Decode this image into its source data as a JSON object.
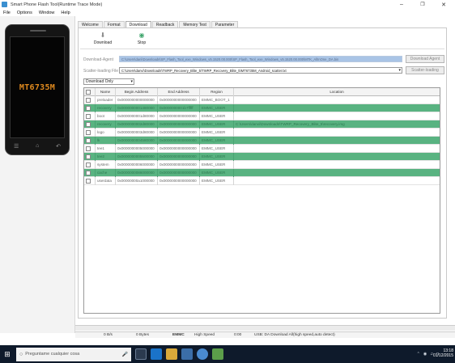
{
  "window": {
    "title": "Smart Phone Flash Tool(Runtime Trace Mode)"
  },
  "menubar": [
    "File",
    "Options",
    "Window",
    "Help"
  ],
  "phone": {
    "model": "MT6735M"
  },
  "tabs": [
    "Welcome",
    "Format",
    "Download",
    "Readback",
    "Memory Test",
    "Parameter"
  ],
  "toolbar": {
    "download_label": "Download",
    "stop_label": "Stop"
  },
  "fields": {
    "download_agent_label": "Download-Agent",
    "download_agent_value": "C:\\Users\\dani\\Downloads\\SP_Flash_Tool_exe_Windows_v5.1520.00.000\\SP_Flash_Tool_exe_Windows_v5.1520.00.000\\MTK_AllInOne_DA.bin",
    "download_agent_button": "Download Agent",
    "scatter_label": "Scatter-loading File",
    "scatter_value": "C:\\Users\\danvi\\Downloads\\TWRP_Recovery_Blite_5\\TWRP_Recovery_Blite_5\\MT6735M_Android_scatter.txt",
    "scatter_button": "Scatter-loading",
    "mode": "Download Only"
  },
  "table": {
    "headers": [
      "",
      "Name",
      "Begin Address",
      "End Address",
      "Region",
      "Location"
    ],
    "rows": [
      {
        "name": "preloader",
        "begin": "0x0000000000000000",
        "end": "0x0000000000000000",
        "region": "EMMC_BOOT_1",
        "location": "",
        "green": false
      },
      {
        "name": "recovery",
        "begin": "0x0000000001480000",
        "end": "0x0000000001b7fffff",
        "region": "EMMC_USER",
        "location": "",
        "green": true
      },
      {
        "name": "boot",
        "begin": "0x0000000001d80000",
        "end": "0x0000000000000000",
        "region": "EMMC_USER",
        "location": "",
        "green": false
      },
      {
        "name": "recovery",
        "begin": "0x0000000002d80000",
        "end": "0x0000000000000000",
        "region": "EMMC_USER",
        "location": "C:\\Users\\danvi\\Downloads\\TWRP_Recovery_Blite_5\\recovery.img",
        "green": true
      },
      {
        "name": "logo",
        "begin": "0x0000000003d80000",
        "end": "0x0000000000000000",
        "region": "EMMC_USER",
        "location": "",
        "green": false
      },
      {
        "name": "lk",
        "begin": "0x0000000004580000",
        "end": "0x0000000000000000",
        "region": "EMMC_USER",
        "location": "",
        "green": true
      },
      {
        "name": "tee1",
        "begin": "0x0000000005000000",
        "end": "0x0000000000000000",
        "region": "EMMC_USER",
        "location": "",
        "green": false
      },
      {
        "name": "tee2",
        "begin": "0x0000000005500000",
        "end": "0x0000000000000000",
        "region": "EMMC_USER",
        "location": "",
        "green": true
      },
      {
        "name": "system",
        "begin": "0x0000000006000000",
        "end": "0x0000000000000000",
        "region": "EMMC_USER",
        "location": "",
        "green": false
      },
      {
        "name": "cache",
        "begin": "0x0000000086000000",
        "end": "0x0000000000000000",
        "region": "EMMC_USER",
        "location": "",
        "green": true
      },
      {
        "name": "userdata",
        "begin": "0x00000000a1000000",
        "end": "0x0000000000000000",
        "region": "EMMC_USER",
        "location": "",
        "green": false
      }
    ]
  },
  "statusbar": {
    "speed": "0 B/s",
    "bytes": "0 Bytes",
    "storage": "EMMC",
    "usb_speed": "High Speed",
    "time": "0:00",
    "message": "USB: DA Download All(high speed,auto detect)"
  },
  "taskbar": {
    "search_placeholder": "Preguntame cualquier cosa",
    "time": "13:18",
    "date": "01/12/2015"
  }
}
